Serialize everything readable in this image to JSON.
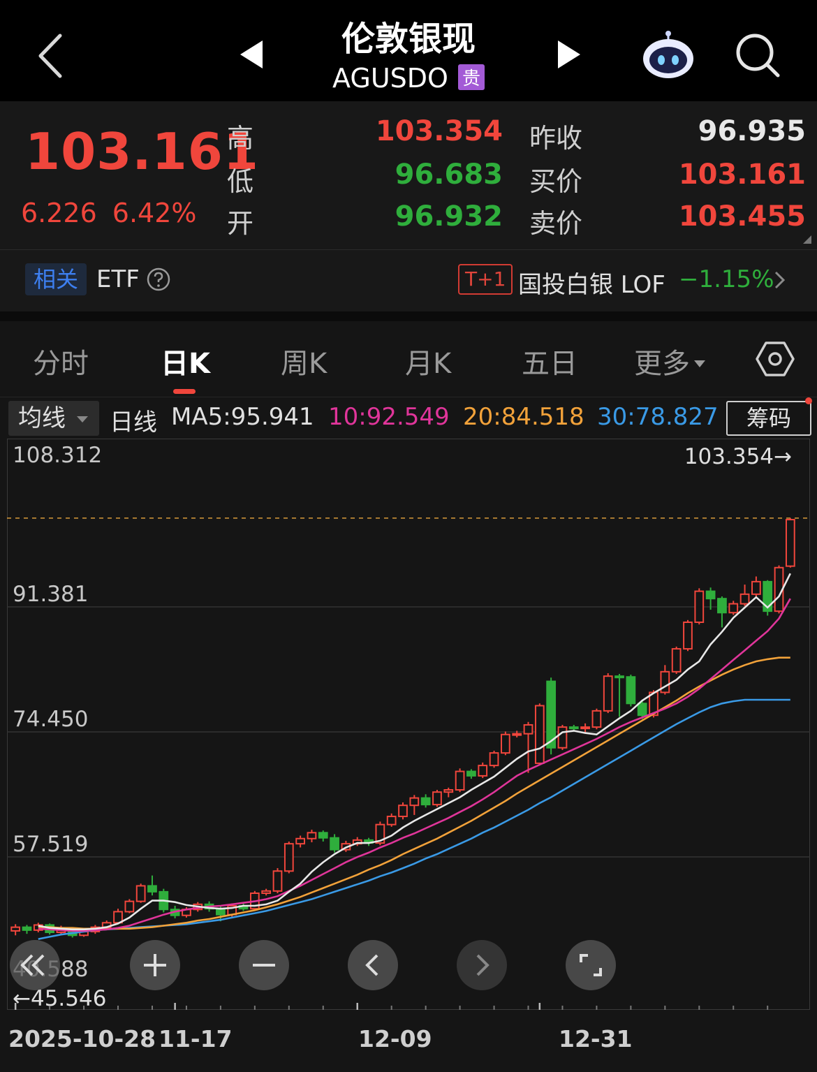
{
  "header": {
    "title": "伦敦银现",
    "code": "AGUSDO",
    "badge": "贵"
  },
  "quote": {
    "last": "103.161",
    "change": "6.226",
    "change_pct": "6.42%",
    "high_label": "高",
    "high": "103.354",
    "low_label": "低",
    "low": "96.683",
    "open_label": "开",
    "open": "96.932",
    "prev_close_label": "昨收",
    "prev_close": "96.935",
    "bid_label": "买价",
    "bid": "103.161",
    "ask_label": "卖价",
    "ask": "103.455"
  },
  "etf": {
    "related_tag": "相关",
    "etf_label": "ETF",
    "t1_tag": "T+1",
    "fund_name": "国投白银 LOF",
    "fund_change": "−1.15%"
  },
  "tabs": [
    {
      "label": "分时",
      "active": false
    },
    {
      "label": "日K",
      "active": true
    },
    {
      "label": "周K",
      "active": false
    },
    {
      "label": "月K",
      "active": false
    },
    {
      "label": "五日",
      "active": false
    },
    {
      "label": "更多",
      "active": false
    }
  ],
  "ma_bar": {
    "select": "均线",
    "period": "日线",
    "ma5": "MA5:95.941",
    "ma10": "10:92.549",
    "ma20": "20:84.518",
    "ma30": "30:78.827",
    "chip_button": "筹码"
  },
  "colors": {
    "up": "#f0463c",
    "down": "#2fae3c",
    "ma5": "#e8e8e8",
    "ma10": "#e0359a",
    "ma20": "#f2a23a",
    "ma30": "#3a9ae6"
  },
  "chart_data": {
    "type": "candlestick",
    "y_ticks": [
      "108.312",
      "91.381",
      "74.450",
      "57.519",
      "40.588"
    ],
    "ylim": [
      40.588,
      108.312
    ],
    "max_marker": "103.354→",
    "min_marker": "←45.546",
    "x_ticks": [
      "2025-10-28",
      "11-17",
      "12-09",
      "12-31"
    ],
    "x_tick_indices": [
      0,
      14,
      30,
      46
    ],
    "candles": [
      [
        47.5,
        48.0,
        46.9,
        48.4
      ],
      [
        48.0,
        47.6,
        47.1,
        48.3
      ],
      [
        47.6,
        48.3,
        47.3,
        48.6
      ],
      [
        48.3,
        47.3,
        47.0,
        48.5
      ],
      [
        47.3,
        47.8,
        47.0,
        48.2
      ],
      [
        47.8,
        46.9,
        46.6,
        48.0
      ],
      [
        46.9,
        47.4,
        46.7,
        47.8
      ],
      [
        47.4,
        48.0,
        47.1,
        48.3
      ],
      [
        48.0,
        48.6,
        47.7,
        48.9
      ],
      [
        48.6,
        50.1,
        48.4,
        50.5
      ],
      [
        50.1,
        51.5,
        49.9,
        51.8
      ],
      [
        51.5,
        53.6,
        51.3,
        53.9
      ],
      [
        53.6,
        52.8,
        52.3,
        55.0
      ],
      [
        52.8,
        50.4,
        50.0,
        53.2
      ],
      [
        50.4,
        49.6,
        49.2,
        50.9
      ],
      [
        49.6,
        50.4,
        49.3,
        50.7
      ],
      [
        50.4,
        51.1,
        50.1,
        51.4
      ],
      [
        51.1,
        50.5,
        50.1,
        51.5
      ],
      [
        50.5,
        49.7,
        48.8,
        50.8
      ],
      [
        49.7,
        50.9,
        49.4,
        51.2
      ],
      [
        50.9,
        50.5,
        50.2,
        51.2
      ],
      [
        50.5,
        52.6,
        50.3,
        52.9
      ],
      [
        52.6,
        52.9,
        52.3,
        53.2
      ],
      [
        52.9,
        55.6,
        52.6,
        56.0
      ],
      [
        55.6,
        59.3,
        55.3,
        59.6
      ],
      [
        59.3,
        60.0,
        58.8,
        60.4
      ],
      [
        60.0,
        60.8,
        59.5,
        61.2
      ],
      [
        60.8,
        60.1,
        59.6,
        61.1
      ],
      [
        60.1,
        58.5,
        58.1,
        60.6
      ],
      [
        58.5,
        59.3,
        58.2,
        59.7
      ],
      [
        59.3,
        59.8,
        59.0,
        60.2
      ],
      [
        59.8,
        59.4,
        59.0,
        60.1
      ],
      [
        59.4,
        61.9,
        59.1,
        62.3
      ],
      [
        61.9,
        63.0,
        61.6,
        63.4
      ],
      [
        63.0,
        64.5,
        62.6,
        64.9
      ],
      [
        64.5,
        65.5,
        63.2,
        65.9
      ],
      [
        65.5,
        64.6,
        64.2,
        66.0
      ],
      [
        64.6,
        66.3,
        64.3,
        66.6
      ],
      [
        66.3,
        66.6,
        65.6,
        66.9
      ],
      [
        66.6,
        69.1,
        66.3,
        69.5
      ],
      [
        69.1,
        68.5,
        68.1,
        69.4
      ],
      [
        68.5,
        69.9,
        68.2,
        70.3
      ],
      [
        69.9,
        71.6,
        69.6,
        71.9
      ],
      [
        71.6,
        74.1,
        71.3,
        74.5
      ],
      [
        74.1,
        74.2,
        73.7,
        74.6
      ],
      [
        74.2,
        75.4,
        68.9,
        75.8
      ],
      [
        70.2,
        78.0,
        70.0,
        78.3
      ],
      [
        81.3,
        72.3,
        71.4,
        81.8
      ],
      [
        72.3,
        75.1,
        72.0,
        75.4
      ],
      [
        75.1,
        75.0,
        74.6,
        75.4
      ],
      [
        75.0,
        75.1,
        74.2,
        75.6
      ],
      [
        75.1,
        77.3,
        74.8,
        77.6
      ],
      [
        77.3,
        82.0,
        77.0,
        82.4
      ],
      [
        82.0,
        81.9,
        76.5,
        82.3
      ],
      [
        81.9,
        78.3,
        77.9,
        82.2
      ],
      [
        78.3,
        76.7,
        76.2,
        78.6
      ],
      [
        76.7,
        79.8,
        76.4,
        80.1
      ],
      [
        79.8,
        82.6,
        79.5,
        83.5
      ],
      [
        82.6,
        85.7,
        82.3,
        86.0
      ],
      [
        85.7,
        89.3,
        85.4,
        89.6
      ],
      [
        89.3,
        93.5,
        89.0,
        93.9
      ],
      [
        93.5,
        92.5,
        91.0,
        94.0
      ],
      [
        92.5,
        90.6,
        88.6,
        92.8
      ],
      [
        90.6,
        91.8,
        90.3,
        92.2
      ],
      [
        91.8,
        93.1,
        91.5,
        94.4
      ],
      [
        93.1,
        94.8,
        92.8,
        95.5
      ],
      [
        94.8,
        90.8,
        90.2,
        95.0
      ],
      [
        90.8,
        96.7,
        90.5,
        97.0
      ],
      [
        96.9,
        103.2,
        96.7,
        103.4
      ]
    ],
    "ma5": [
      48.2,
      47.9,
      47.8,
      47.7,
      47.7,
      47.8,
      48.0,
      48.5,
      49.3,
      50.5,
      51.6,
      51.6,
      51.4,
      51.0,
      50.8,
      50.6,
      50.5,
      50.6,
      50.9,
      50.9,
      51.1,
      51.6,
      52.8,
      53.9,
      55.5,
      56.8,
      57.9,
      58.8,
      59.4,
      59.4,
      59.7,
      60.4,
      61.5,
      62.4,
      63.2,
      64.0,
      64.8,
      65.6,
      66.6,
      67.5,
      68.4,
      69.6,
      70.8,
      71.8,
      72.2,
      73.2,
      74.4,
      74.6,
      74.3,
      74.1,
      75.2,
      76.3,
      77.3,
      78.7,
      79.7,
      80.6,
      81.5,
      82.9,
      84.0,
      86.3,
      88.0,
      89.9,
      91.3,
      92.7,
      91.3,
      92.8,
      95.9
    ],
    "ma10": [
      47.8,
      47.7,
      47.6,
      47.5,
      47.5,
      47.6,
      47.7,
      47.9,
      48.2,
      48.7,
      49.2,
      49.7,
      50.1,
      50.4,
      50.6,
      50.8,
      50.9,
      51.1,
      51.3,
      51.5,
      51.8,
      52.2,
      52.9,
      53.6,
      54.4,
      55.2,
      56.0,
      56.8,
      57.5,
      58.1,
      58.8,
      59.4,
      60.1,
      60.7,
      61.4,
      62.1,
      62.8,
      63.6,
      64.4,
      65.3,
      66.3,
      67.4,
      68.5,
      69.3,
      70.0,
      70.7,
      71.4,
      72.1,
      72.8,
      73.5,
      74.3,
      75.1,
      75.8,
      76.4,
      77.0,
      77.6,
      78.3,
      79.2,
      80.3,
      81.6,
      82.9,
      84.2,
      85.5,
      86.8,
      88.1,
      89.8,
      92.5
    ],
    "ma20": [
      48.0,
      48.0,
      47.9,
      47.9,
      47.8,
      47.8,
      47.8,
      47.8,
      47.8,
      47.9,
      48.0,
      48.2,
      48.4,
      48.6,
      48.9,
      49.1,
      49.4,
      49.7,
      50.0,
      50.3,
      50.7,
      51.1,
      51.6,
      52.1,
      52.7,
      53.3,
      53.9,
      54.5,
      55.1,
      55.8,
      56.4,
      57.1,
      57.9,
      58.6,
      59.3,
      60.0,
      60.8,
      61.6,
      62.4,
      63.3,
      64.2,
      65.1,
      66.1,
      67.0,
      67.9,
      68.8,
      69.7,
      70.6,
      71.5,
      72.4,
      73.3,
      74.2,
      75.1,
      76.0,
      76.9,
      77.8,
      78.7,
      79.7,
      80.6,
      81.4,
      82.2,
      82.9,
      83.5,
      84.0,
      84.3,
      84.5,
      84.5
    ],
    "ma30": [
      46.4,
      46.7,
      47.0,
      47.2,
      47.4,
      47.6,
      47.7,
      47.8,
      47.9,
      48.0,
      48.1,
      48.2,
      48.3,
      48.4,
      48.6,
      48.8,
      49.0,
      49.3,
      49.6,
      49.9,
      50.2,
      50.6,
      51.0,
      51.4,
      51.8,
      52.3,
      52.8,
      53.3,
      53.8,
      54.3,
      54.9,
      55.4,
      56.0,
      56.6,
      57.3,
      57.9,
      58.6,
      59.3,
      60.0,
      60.8,
      61.5,
      62.3,
      63.1,
      63.9,
      64.8,
      65.6,
      66.5,
      67.4,
      68.3,
      69.2,
      70.1,
      71.0,
      71.9,
      72.8,
      73.7,
      74.6,
      75.5,
      76.3,
      77.1,
      77.8,
      78.3,
      78.6,
      78.8,
      78.8,
      78.8,
      78.8,
      78.8
    ]
  }
}
